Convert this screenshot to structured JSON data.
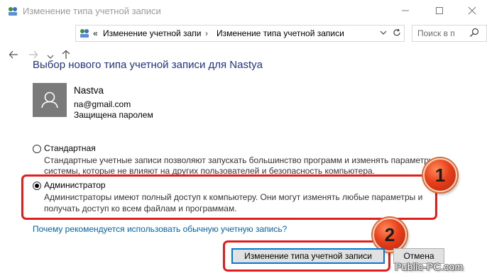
{
  "window": {
    "title": "Изменение типа учетной записи"
  },
  "address": {
    "prefix": "«",
    "crumbs": [
      "Изменение учетной запи",
      "Изменение типа учетной записи"
    ],
    "search_placeholder": "Поиск в п"
  },
  "page": {
    "heading": "Выбор нового типа учетной записи для Nastya",
    "user": {
      "name": "Nastva",
      "email": "na@gmail.com",
      "status": "Защищена паролем"
    },
    "options": [
      {
        "label": "Стандартная",
        "selected": false,
        "desc_line1": "Стандартные учетные записи позволяют запускать большинство программ и изменять параметры",
        "desc_line2": "системы, которые не влияют на других пользователей и безопасность компьютера."
      },
      {
        "label": "Администратор",
        "selected": true,
        "desc_line1": "Администраторы имеют полный доступ к компьютеру. Они могут изменять любые параметры и",
        "desc_line2": "получать доступ ко всем файлам и программам."
      }
    ],
    "link": "Почему рекомендуется использовать обычную учетную запись?"
  },
  "buttons": {
    "primary": "Изменение типа учетной записи",
    "cancel": "Отмена"
  },
  "annotations": {
    "badge1": "1",
    "badge2": "2",
    "highlight_color": "#e21d1d"
  },
  "watermark": "Public-PC.com",
  "colors": {
    "heading": "#1e3287",
    "link": "#0063b1",
    "accent": "#0078d7"
  }
}
